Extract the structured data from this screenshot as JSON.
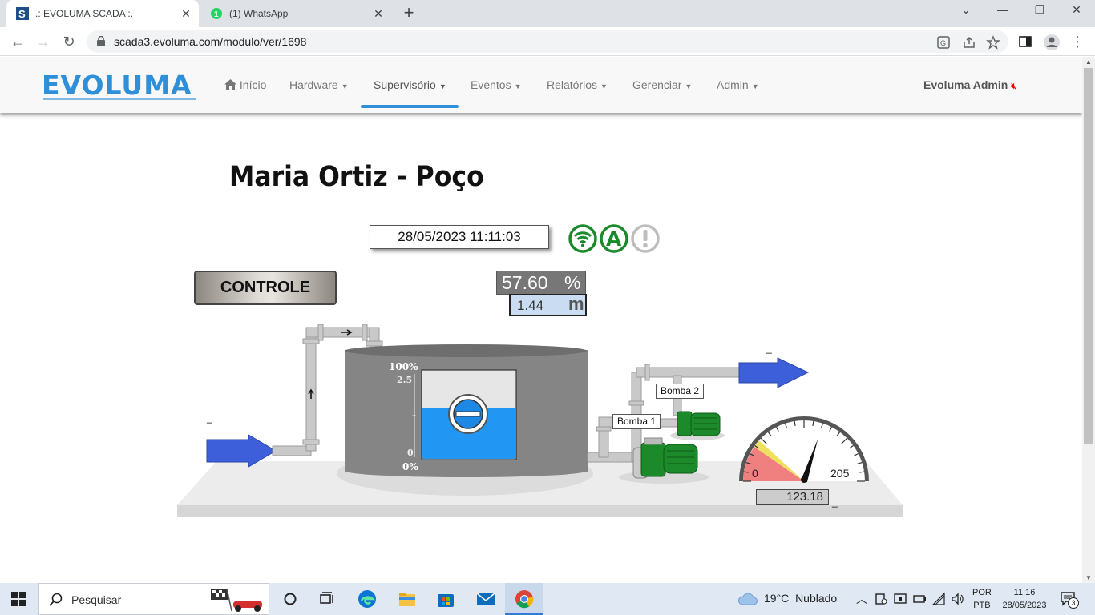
{
  "browser": {
    "tabs": [
      {
        "title": ".: EVOLUMA SCADA :.",
        "active": true
      },
      {
        "title": "(1) WhatsApp",
        "active": false,
        "badge": "1"
      }
    ],
    "url": "scada3.evoluma.com/modulo/ver/1698"
  },
  "navbar": {
    "logo": "EVOLUMA",
    "items": [
      {
        "label": "Início"
      },
      {
        "label": "Hardware"
      },
      {
        "label": "Supervisório"
      },
      {
        "label": "Eventos"
      },
      {
        "label": "Relatórios"
      },
      {
        "label": "Gerenciar"
      },
      {
        "label": "Admin"
      }
    ],
    "active_item": "Supervisório",
    "user": "Evoluma Admin"
  },
  "page": {
    "title": "Maria Ortiz - Poço",
    "datetime": "28/05/2023 11:11:03",
    "status_icons": [
      "wifi-icon",
      "auto-mode-icon",
      "alert-icon"
    ],
    "control_button": "CONTROLE",
    "level_percent": "57.60",
    "level_percent_unit": "%",
    "level_meters": "1.44",
    "level_meters_unit": "m",
    "tank": {
      "top_label": "100%",
      "bottom_label": "0%",
      "scale_max": "2.5",
      "scale_min": "0",
      "fill_fraction": 0.576
    },
    "pumps": [
      {
        "label": "Bomba 1"
      },
      {
        "label": "Bomba 2"
      }
    ],
    "gauge": {
      "min_label": "0",
      "max_label": "205",
      "value": "123.18",
      "value_number": 123.18,
      "max": 205
    },
    "dash": "_"
  },
  "taskbar": {
    "search_placeholder": "Pesquisar",
    "weather_temp": "19°C",
    "weather_desc": "Nublado",
    "lang_1": "POR",
    "lang_2": "PTB",
    "time": "11:16",
    "date": "28/05/2023",
    "notification_count": "3"
  },
  "colors": {
    "brand": "#2f8fd8",
    "status_green": "#1a8a2a",
    "water": "#2196f3",
    "arrow": "#3d5fd9",
    "pump": "#1c8a2a"
  }
}
